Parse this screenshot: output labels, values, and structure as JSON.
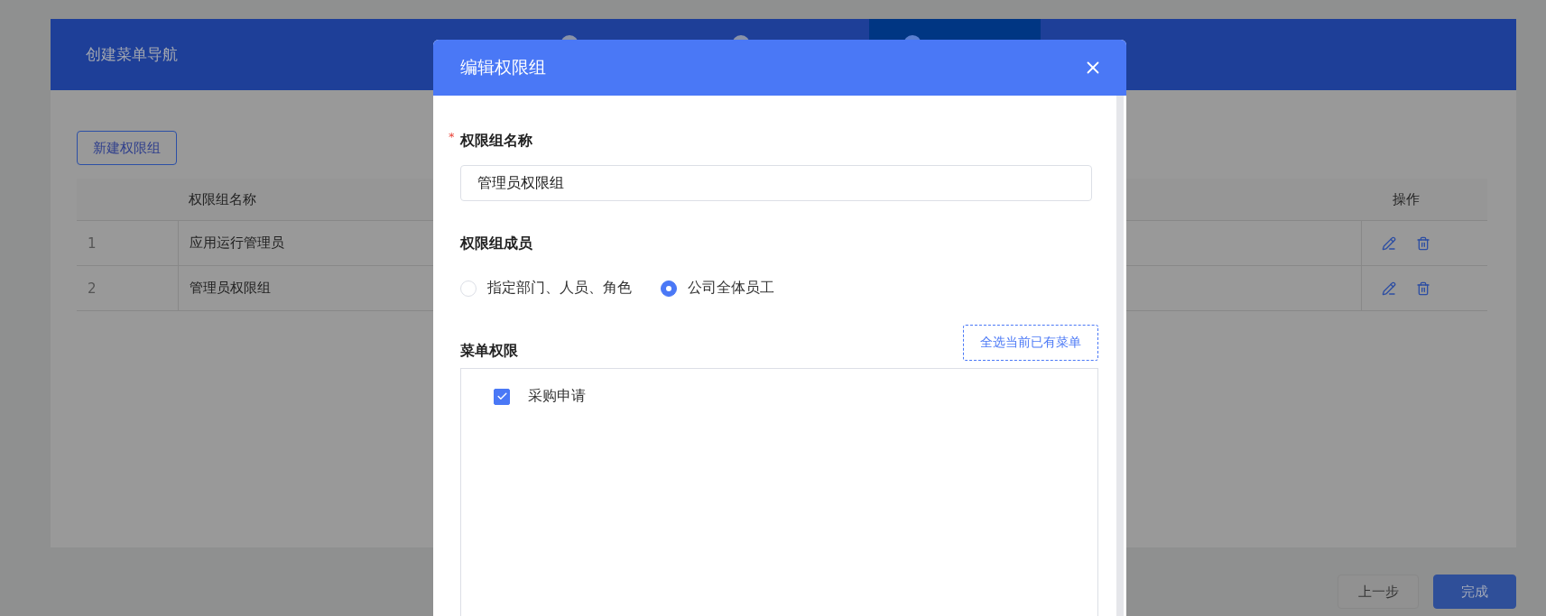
{
  "page": {
    "title": "创建菜单导航",
    "steps": [
      {
        "selected": false
      },
      {
        "selected": false
      },
      {
        "selected": true
      }
    ],
    "new_button": "新建权限组",
    "table": {
      "columns": [
        "权限组名称",
        "操作"
      ],
      "rows": [
        {
          "index": "1",
          "name": "应用运行管理员"
        },
        {
          "index": "2",
          "name": "管理员权限组"
        }
      ]
    },
    "footer_buttons": [
      {
        "label": "上一步",
        "kind": "secondary"
      },
      {
        "label": "完成",
        "kind": "primary"
      }
    ]
  },
  "dialog": {
    "title": "编辑权限组",
    "name_field": {
      "label": "权限组名称",
      "required_mark": "*",
      "value": "管理员权限组"
    },
    "members": {
      "label": "权限组成员",
      "options": [
        {
          "label": "指定部门、人员、角色",
          "selected": false
        },
        {
          "label": "公司全体员工",
          "selected": true
        }
      ]
    },
    "menu_permissions": {
      "label": "菜单权限",
      "select_all_button": "全选当前已有菜单",
      "items": [
        {
          "label": "采购申请",
          "checked": true
        }
      ]
    }
  }
}
